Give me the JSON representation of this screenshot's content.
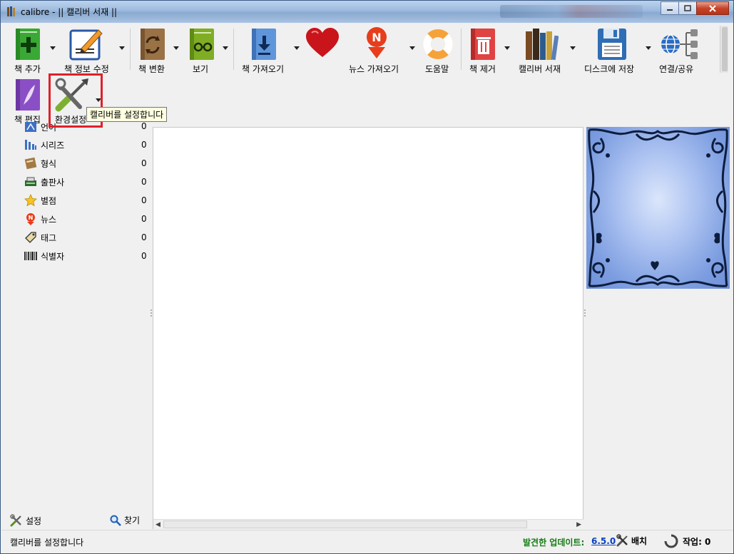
{
  "window": {
    "title": "calibre - || 캘리버 서재 ||"
  },
  "toolbar": {
    "items": [
      {
        "label": "책 추가",
        "icon": "add-book-icon"
      },
      {
        "label": "책 정보 수정",
        "icon": "edit-metadata-icon"
      },
      {
        "label": "책 변환",
        "icon": "convert-book-icon"
      },
      {
        "label": "보기",
        "icon": "view-book-icon"
      },
      {
        "label": "책 가져오기",
        "icon": "get-books-icon"
      },
      {
        "label": "",
        "icon": "donate-heart-icon"
      },
      {
        "label": "뉴스 가져오기",
        "icon": "fetch-news-icon"
      },
      {
        "label": "도움말",
        "icon": "help-lifebuoy-icon"
      },
      {
        "label": "책 제거",
        "icon": "remove-book-icon"
      },
      {
        "label": "캘리버 서재",
        "icon": "calibre-library-icon"
      },
      {
        "label": "디스크에 저장",
        "icon": "save-to-disk-icon"
      },
      {
        "label": "연결/공유",
        "icon": "connect-share-icon"
      },
      {
        "label": "책 편집",
        "icon": "edit-book-icon"
      },
      {
        "label": "환경설정",
        "icon": "preferences-icon"
      }
    ],
    "overflow": "»",
    "tooltip": "캘리버를 설정합니다"
  },
  "tag_browser": {
    "items": [
      {
        "label": "언어",
        "count": "0",
        "icon": "language-icon"
      },
      {
        "label": "시리즈",
        "count": "0",
        "icon": "series-icon"
      },
      {
        "label": "형식",
        "count": "0",
        "icon": "format-icon"
      },
      {
        "label": "출판사",
        "count": "0",
        "icon": "publisher-icon"
      },
      {
        "label": "별점",
        "count": "0",
        "icon": "star-icon"
      },
      {
        "label": "뉴스",
        "count": "0",
        "icon": "news-icon"
      },
      {
        "label": "태그",
        "count": "0",
        "icon": "tag-icon"
      },
      {
        "label": "식별자",
        "count": "0",
        "icon": "barcode-icon"
      }
    ],
    "settings_label": "설정",
    "find_label": "찾기"
  },
  "status": {
    "message": "캘리버를 설정합니다",
    "update_label": "발견한 업데이트:",
    "update_version": "6.5.0",
    "layout_label": "배치",
    "jobs_label": "작업: 0"
  }
}
